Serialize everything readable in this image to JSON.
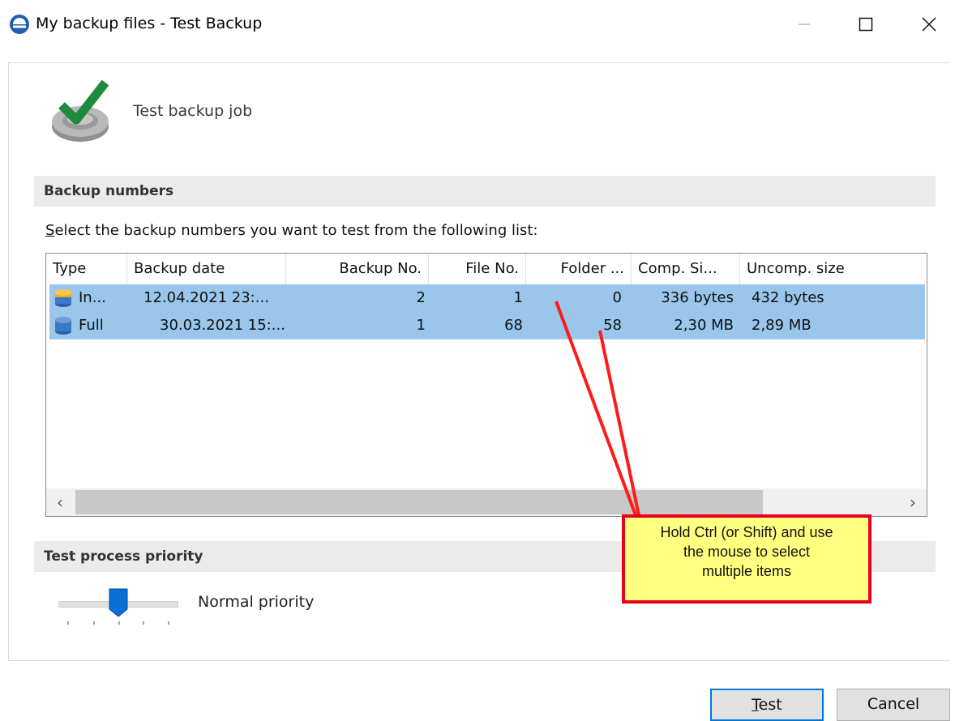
{
  "window": {
    "title": "My backup files - Test Backup",
    "controls": [
      "minimize-icon",
      "maximize-icon",
      "close-icon"
    ]
  },
  "header": {
    "job_title": "Test backup job",
    "icon": "check-disk-icon"
  },
  "sections": {
    "backup_numbers": "Backup numbers",
    "priority": "Test process priority"
  },
  "instruction": {
    "first_letter": "S",
    "rest": "elect the backup numbers you want to test from the following list:"
  },
  "list": {
    "columns": [
      "Type",
      "Backup date",
      "Backup No.",
      "File No.",
      "Folder ...",
      "Comp. Si...",
      "Uncomp. size"
    ],
    "rows": [
      {
        "type": "In...",
        "date": "12.04.2021 23:...",
        "backup_no": "2",
        "file_no": "1",
        "folder": "0",
        "comp": "336 bytes",
        "uncomp": "432 bytes",
        "icon_color": "#f5a623"
      },
      {
        "type": "Full",
        "date": "30.03.2021 15:...",
        "backup_no": "1",
        "file_no": "68",
        "folder": "58",
        "comp": "2,30 MB",
        "uncomp": "2,89 MB",
        "icon_color": "#3b78c5"
      }
    ],
    "selection_color": "#99c6ea"
  },
  "priority": {
    "label": "Normal priority",
    "level": 0.5
  },
  "callout": {
    "lines": [
      "Hold Ctrl (or Shift) and use",
      "the mouse to select",
      "multiple items"
    ]
  },
  "buttons": {
    "test_first": "T",
    "test_rest": "est",
    "cancel": "Cancel"
  }
}
